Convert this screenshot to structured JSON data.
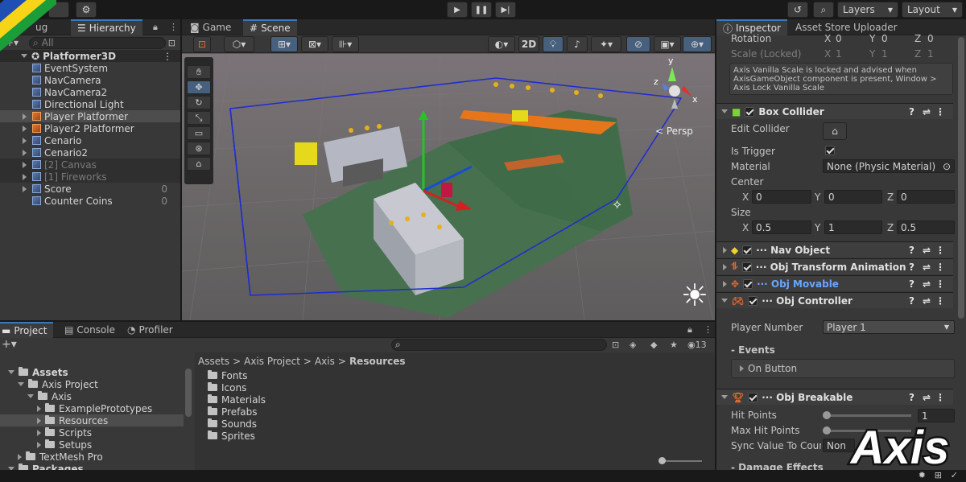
{
  "toolbar": {
    "layers": "Layers",
    "layout": "Layout"
  },
  "hierarchy": {
    "tab_debug": "ug",
    "tab_hierarchy": "Hierarchy",
    "search_placeholder": "All",
    "scene": "Platformer3D",
    "items": [
      {
        "label": "EventSystem",
        "value": ""
      },
      {
        "label": "NavCamera",
        "value": ""
      },
      {
        "label": "NavCamera2",
        "value": ""
      },
      {
        "label": "Directional Light",
        "value": ""
      },
      {
        "label": "Player Platformer",
        "value": ""
      },
      {
        "label": "Player2 Platformer",
        "value": ""
      },
      {
        "label": "Cenario",
        "value": ""
      },
      {
        "label": "Cenario2",
        "value": ""
      },
      {
        "label": "[2] Canvas",
        "value": ""
      },
      {
        "label": "[1] Fireworks",
        "value": ""
      },
      {
        "label": "Score",
        "value": "0"
      },
      {
        "label": "Counter Coins",
        "value": "0"
      }
    ]
  },
  "scene": {
    "tab_game": "Game",
    "tab_scene": "Scene",
    "btn_2d": "2D",
    "persp": "< Persp",
    "gizmo_x": "x",
    "gizmo_y": "y",
    "gizmo_z": "z"
  },
  "project": {
    "tab_project": "Project",
    "tab_console": "Console",
    "tab_profiler": "Profiler",
    "add": "+",
    "count": "13",
    "tree": [
      {
        "label": "Assets",
        "bold": true
      },
      {
        "label": "Axis Project"
      },
      {
        "label": "Axis"
      },
      {
        "label": "ExamplePrototypes"
      },
      {
        "label": "Resources"
      },
      {
        "label": "Scripts"
      },
      {
        "label": "Setups"
      },
      {
        "label": "TextMesh Pro"
      },
      {
        "label": "Packages",
        "bold": true
      }
    ],
    "breadcrumb": [
      "Assets",
      "Axis Project",
      "Axis",
      "Resources"
    ],
    "folders": [
      "Fonts",
      "Icons",
      "Materials",
      "Prefabs",
      "Sounds",
      "Sprites"
    ]
  },
  "inspector": {
    "tab_inspector": "Inspector",
    "tab_uploader": "Asset Store Uploader",
    "rotation": {
      "label": "Rotation",
      "x": "0",
      "y": "0",
      "z": "0"
    },
    "scale": {
      "label": "Scale (Locked)",
      "x": "1",
      "y": "1",
      "z": "1"
    },
    "axis_labels": {
      "x": "X",
      "y": "Y",
      "z": "Z"
    },
    "warning": "Axis Vanilla Scale is locked and advised when AxisGameObject component is present, Window > Axis Lock Vanilla Scale",
    "box_collider": {
      "title": "Box Collider",
      "edit": "Edit Collider",
      "trigger": "Is Trigger",
      "material": "Material",
      "material_value": "None (Physic Material)",
      "center": "Center",
      "cx": "0",
      "cy": "0",
      "cz": "0",
      "size": "Size",
      "sx": "0.5",
      "sy": "1",
      "sz": "0.5"
    },
    "nav_object": "··· Nav Object",
    "obj_transform": "··· Obj Transform Animation",
    "obj_movable": "··· Obj Movable",
    "obj_controller": "··· Obj Controller",
    "player_number": "Player Number",
    "player_value": "Player 1",
    "events": "- Events",
    "on_button": "On Button",
    "obj_breakable": "··· Obj Breakable",
    "hit_points": "Hit Points",
    "hit_value": "1",
    "max_hit": "Max Hit Points",
    "sync": "Sync Value To Coun",
    "sync_value": "Non",
    "damage": "- Damage Effects"
  },
  "logo": "Axis",
  "colors": {
    "accent": "#3a79bb",
    "selected": "#2c5d87",
    "movable": "#6aa6ff"
  }
}
